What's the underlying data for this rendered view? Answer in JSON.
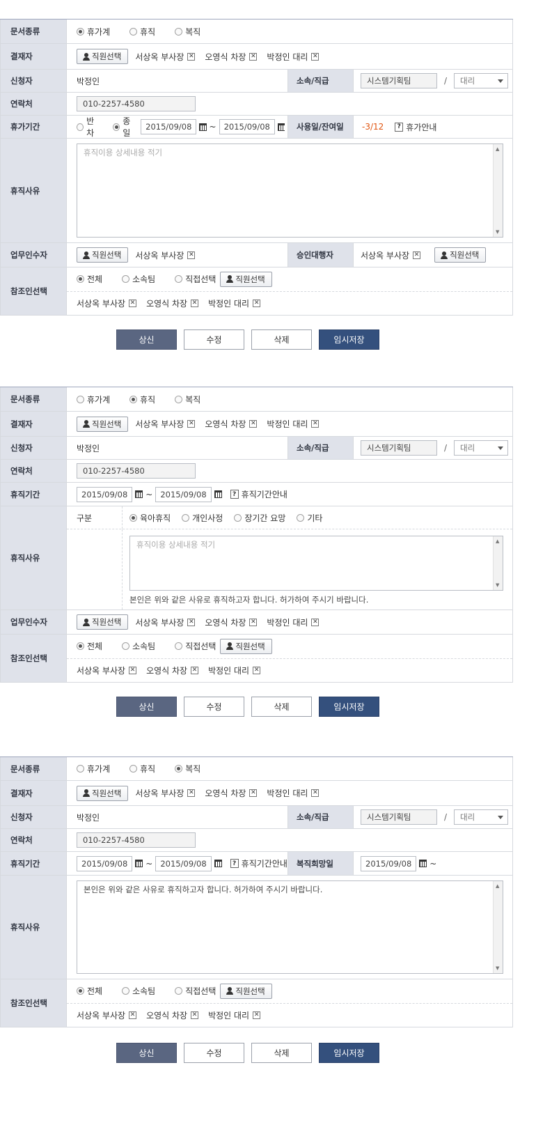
{
  "labels": {
    "doc_type": "문서종류",
    "approver": "결재자",
    "applicant": "신청자",
    "dept": "소속/직급",
    "contact": "연락처",
    "vacation_period": "휴가기간",
    "used_left": "사용일/잔여일",
    "leave_reason": "휴직사유",
    "handover": "업무인수자",
    "proxy": "승인대행자",
    "reference": "참조인선택",
    "leave_period": "휴직기간",
    "return_date": "복직희망일",
    "category": "구분"
  },
  "doc_types": [
    "휴가계",
    "휴직",
    "복직"
  ],
  "half": "반차",
  "full": "종일",
  "emp_select": "직원선택",
  "approvers": [
    "서상옥 부사장",
    "오영식 차장",
    "박정인 대리"
  ],
  "applicant_name": "박정인",
  "team": "시스템기획팀",
  "slash": "/",
  "rank": "대리",
  "phone": "010-2257-4580",
  "date": "2015/09/08",
  "tilde": "~",
  "used": "-3/12",
  "vacation_help": "휴가안내",
  "leave_help": "휴직기간안내",
  "placeholder": "휴직이용 상세내용 적기",
  "ref_options": [
    "전체",
    "소속팀",
    "직접선택"
  ],
  "reasons": [
    "육아휴직",
    "개인사정",
    "장기간 요망",
    "기타"
  ],
  "notice": "본인은 위와 같은 사유로 휴직하고자 합니다. 허가하여 주시기 바랍니다.",
  "buttons": [
    "상신",
    "수정",
    "삭제",
    "임시저장"
  ],
  "x_mark": "✕",
  "colors": {
    "header_bg": "#dfe2ea",
    "btn_dark": "#5a6681",
    "btn_navy": "#34507d",
    "used_color": "#e0540f"
  }
}
